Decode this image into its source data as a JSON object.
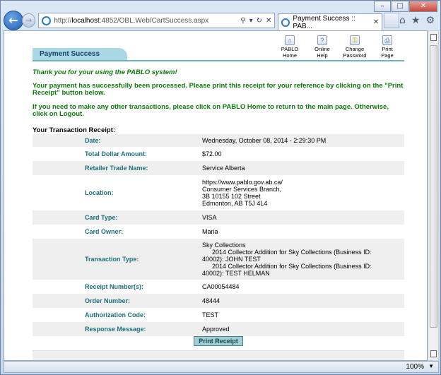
{
  "browser": {
    "url_prefix": "http://",
    "url_host": "localhost",
    "url_rest": ":4852/OBL.Web/CartSuccess.aspx",
    "tab_title": "Payment Success :: PAB...",
    "zoom": "100%"
  },
  "header": {
    "title": "Payment Success",
    "nav": [
      {
        "label_1": "PABLO",
        "label_2": "Home",
        "icon": "home-icon"
      },
      {
        "label_1": "Online",
        "label_2": "Help",
        "icon": "help-icon"
      },
      {
        "label_1": "Change",
        "label_2": "Password",
        "icon": "key-icon"
      },
      {
        "label_1": "Print",
        "label_2": "Page",
        "icon": "print-icon"
      }
    ]
  },
  "messages": {
    "thanks": "Thank you for your using the PABLO system!",
    "success": "Your payment has successfully been processed. Please print this receipt for your reference by clicking on the \"Print Receipt\" button below.",
    "other": "If you need to make any other transactions, please click on PABLO Home to return to the main page. Otherwise, click on Logout."
  },
  "receipt": {
    "heading": "Your Transaction Receipt:",
    "date_label": "Date:",
    "date": "Wednesday, October 08, 2014 - 2:29:30 PM",
    "amount_label": "Total Dollar Amount:",
    "amount": "$72.00",
    "retailer_label": "Retailer Trade Name:",
    "retailer": "Service Alberta",
    "location_label": "Location:",
    "location_1": "https://www.pablo.gov.ab.ca/",
    "location_2": "Consumer Services Branch,",
    "location_3": "3B 10155 102 Street",
    "location_4": "Edmonton, AB T5J 4L4",
    "card_type_label": "Card Type:",
    "card_type": "VISA",
    "card_owner_label": "Card Owner:",
    "card_owner": "Maria",
    "txn_type_label": "Transaction Type:",
    "txn_1": "Sky Collections",
    "txn_2": "2014 Collector Addition for Sky Collections (Business ID:",
    "txn_3": "40002): JOHN TEST",
    "txn_4": "2014 Collector Addition for Sky Collections (Business ID:",
    "txn_5": "40002): TEST HELMAN",
    "receipt_no_label": "Receipt Number(s):",
    "receipt_no": "CA00054484",
    "order_label": "Order Number:",
    "order": "48444",
    "auth_label": "Authorization Code:",
    "auth": "TEST",
    "response_label": "Response Message:",
    "response": "Approved",
    "print_button": "Print Receipt"
  },
  "colors": {
    "label_teal": "#1a6f7a",
    "message_green": "#0b7a0b",
    "title_tab": "#a9d7e3"
  }
}
